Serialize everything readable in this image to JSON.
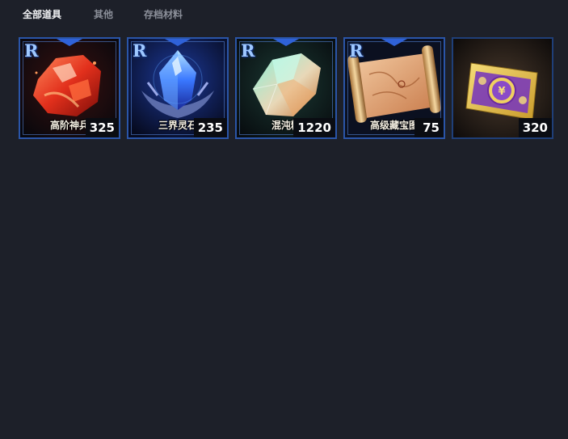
{
  "tabs": [
    {
      "label": "全部道具",
      "active": true
    },
    {
      "label": "其他",
      "active": false
    },
    {
      "label": "存档材料",
      "active": false
    }
  ],
  "items": [
    {
      "rarity": "R",
      "name": "高阶神兵",
      "count": "325",
      "icon": "red-ore-crystal-icon"
    },
    {
      "rarity": "R",
      "name": "三界灵石",
      "count": "235",
      "icon": "blue-soul-crystal-icon"
    },
    {
      "rarity": "R",
      "name": "混沌精",
      "count": "1220",
      "icon": "green-chaos-crystal-icon"
    },
    {
      "rarity": "R",
      "name": "高级藏宝图",
      "count": "75",
      "icon": "treasure-map-scroll-icon"
    },
    {
      "rarity": "",
      "name": "",
      "count": "320",
      "icon": "gold-coupon-ticket-icon"
    }
  ]
}
